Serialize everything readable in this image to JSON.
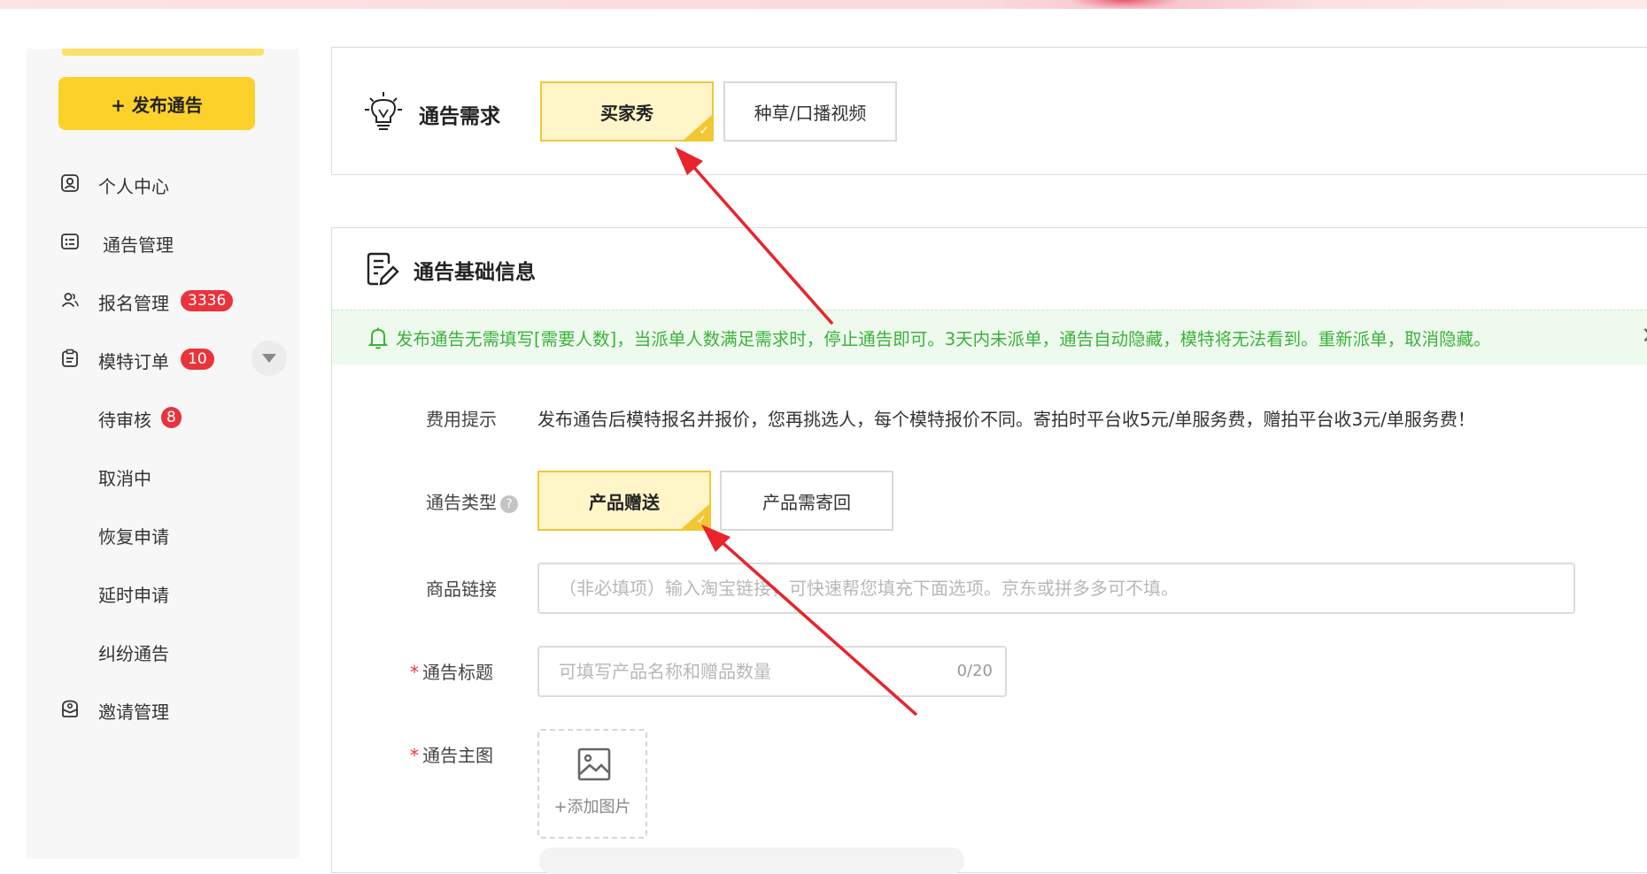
{
  "sidebar": {
    "publish_label": "+ 发布通告",
    "items": [
      {
        "label": "个人中心",
        "icon": "user-icon"
      },
      {
        "label": "通告管理",
        "icon": "list-icon"
      },
      {
        "label": "报名管理",
        "icon": "users-icon",
        "badge": "3336"
      },
      {
        "label": "模特订单",
        "icon": "clipboard-icon",
        "badge": "10"
      },
      {
        "label": "待审核",
        "badge": "8"
      },
      {
        "label": "取消中"
      },
      {
        "label": "恢复申请"
      },
      {
        "label": "延时申请"
      },
      {
        "label": "纠纷通告"
      },
      {
        "label": "邀请管理",
        "icon": "invite-icon"
      }
    ]
  },
  "requirement": {
    "title": "通告需求",
    "options": [
      {
        "label": "买家秀",
        "selected": true
      },
      {
        "label": "种草/口播视频",
        "selected": false
      }
    ]
  },
  "basic": {
    "title": "通告基础信息",
    "notice": "发布通告无需填写[需要人数]，当派单人数满足需求时，停止通告即可。3天内未派单，通告自动隐藏，模特将无法看到。重新派单，取消隐藏。",
    "close_symbol": "✕",
    "fee_label": "费用提示",
    "fee_text": "发布通告后模特报名并报价，您再挑选人，每个模特报价不同。寄拍时平台收5元/单服务费，赠拍平台收3元/单服务费！",
    "type_label": "通告类型",
    "type_help": "?",
    "type_options": [
      {
        "label": "产品赠送",
        "selected": true
      },
      {
        "label": "产品需寄回",
        "selected": false
      }
    ],
    "link_label": "商品链接",
    "link_placeholder": "（非必填项）输入淘宝链接，可快速帮您填充下面选项。京东或拼多多可不填。",
    "title_label": "通告标题",
    "title_placeholder": "可填写产品名称和赠品数量",
    "title_counter": "0/20",
    "image_label": "通告主图",
    "add_image_label": "+添加图片",
    "required_mark": "*"
  },
  "colors": {
    "accent_yellow": "#fcd12a",
    "badge_red": "#e8343c",
    "notice_green": "#3cb13c",
    "arrow_red": "#e8242c"
  }
}
